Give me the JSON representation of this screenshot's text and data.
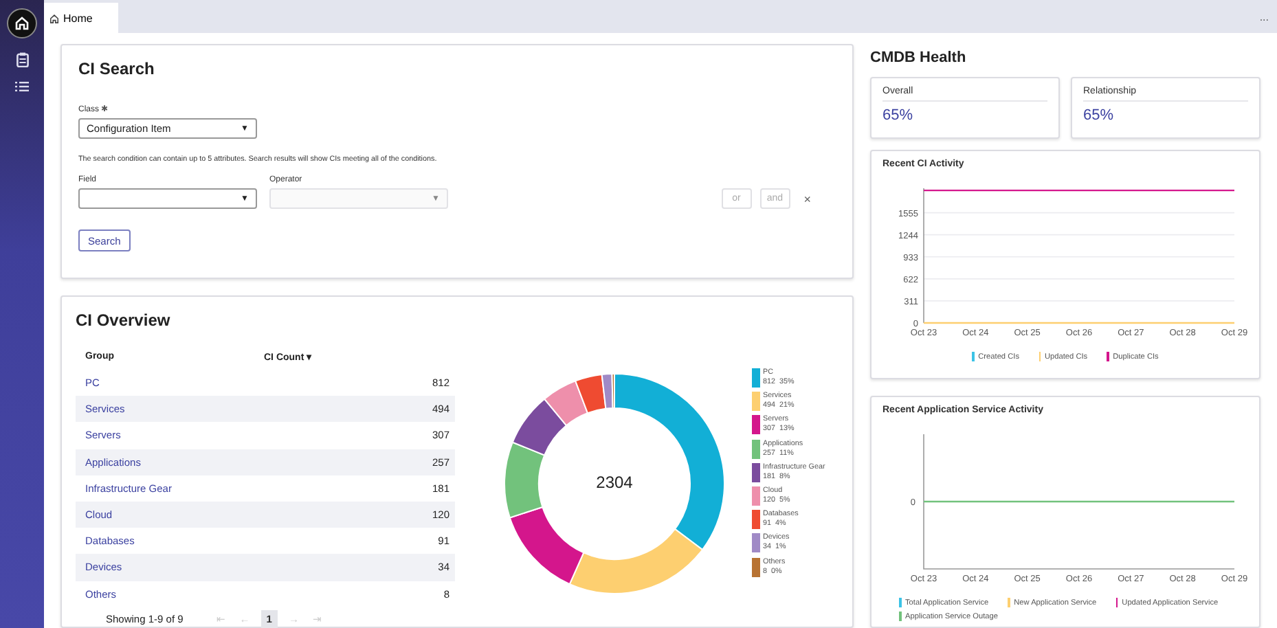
{
  "tab": {
    "label": "Home",
    "selected": true
  },
  "more": "...",
  "search": {
    "title": "CI Search",
    "class_label": "Class",
    "required_mark": "✱",
    "class_value": "Configuration Item",
    "caret": "▼",
    "help": "The search condition can contain up to 5 attributes. Search results will show CIs meeting all of the conditions.",
    "field_label": "Field",
    "operator_label": "Operator",
    "operator_disabled": true,
    "buttons": [
      {
        "label": "or",
        "disabled": true
      },
      {
        "label": "and",
        "disabled": true
      }
    ],
    "remove": "×",
    "search_button": "Search"
  },
  "overview": {
    "title": "CI Overview",
    "columns": [
      "Group",
      "CI Count"
    ],
    "sort_mark": "▾",
    "rows": [
      {
        "group": "PC",
        "count": "812"
      },
      {
        "group": "Services",
        "count": "494"
      },
      {
        "group": "Servers",
        "count": "307"
      },
      {
        "group": "Applications",
        "count": "257"
      },
      {
        "group": "Infrastructure Gear",
        "count": "181"
      },
      {
        "group": "Cloud",
        "count": "120"
      },
      {
        "group": "Databases",
        "count": "91"
      },
      {
        "group": "Devices",
        "count": "34"
      },
      {
        "group": "Others",
        "count": "8"
      }
    ],
    "showing": "Showing 1-9 of 9",
    "pager": [
      {
        "label": "⇤",
        "kind": "nav",
        "disabled": true
      },
      {
        "label": "←",
        "kind": "nav",
        "disabled": true
      },
      {
        "label": "1",
        "kind": "page",
        "selected": true
      },
      {
        "label": "→",
        "kind": "nav",
        "disabled": true
      },
      {
        "label": "⇥",
        "kind": "nav",
        "disabled": true
      }
    ],
    "total": "2304",
    "legend": [
      {
        "count": "812",
        "percent": "35%",
        "color": "#12afd6"
      },
      {
        "count": "494",
        "percent": "21%",
        "color": "#fdcf70"
      },
      {
        "count": "307",
        "percent": "13%",
        "color": "#d4168c"
      },
      {
        "count": "257",
        "percent": "11%",
        "color": "#72c27c"
      },
      {
        "count": "181",
        "percent": "8%",
        "color": "#7b4c9e"
      },
      {
        "count": "120",
        "percent": "5%",
        "color": "#ee8fab"
      },
      {
        "count": "91",
        "percent": "4%",
        "color": "#ef4b31"
      },
      {
        "count": "34",
        "percent": "1%",
        "color": "#a08ac6"
      },
      {
        "count": "8",
        "percent": "0%",
        "color": "#b87333"
      }
    ],
    "chart_data": {
      "type": "donut",
      "categories": [
        "PC",
        "Services",
        "Servers",
        "Applications",
        "Infrastructure Gear",
        "Cloud",
        "Databases",
        "Devices",
        "Others"
      ],
      "values": [
        35.24,
        21.44,
        13.32,
        11.15,
        7.86,
        5.21,
        3.95,
        1.48,
        0.35
      ]
    }
  },
  "health": {
    "title": "CMDB Health",
    "scores": [
      {
        "label": "Overall",
        "value": "65%"
      },
      {
        "label": "Relationship",
        "value": "65%"
      }
    ],
    "charts": [
      {
        "title": "Recent CI Activity",
        "chart_data": {
          "type": "line",
          "x": [
            "Oct 23",
            "Oct 24",
            "Oct 25",
            "Oct 26",
            "Oct 27",
            "Oct 28",
            "Oct 29"
          ],
          "yticks": [
            0,
            311,
            622,
            933,
            1244,
            1555
          ],
          "ylim": [
            0,
            1900
          ],
          "grid": true,
          "series": [
            {
              "name": "Created CIs",
              "color": "#3cc3e6",
              "values": [
                null,
                null,
                null,
                null,
                null,
                null,
                null
              ]
            },
            {
              "name": "Updated CIs",
              "color": "#fdcf70",
              "values": [
                0,
                0,
                0,
                0,
                0,
                0,
                0
              ]
            },
            {
              "name": "Duplicate CIs",
              "color": "#d4168c",
              "values": [
                1870,
                1870,
                1870,
                1870,
                1870,
                1870,
                1870
              ]
            }
          ]
        }
      },
      {
        "title": "Recent Application Service Activity",
        "y_label": "0",
        "x_labels": [
          "Oct 23",
          "Oct 24",
          "Oct 25",
          "Oct 26",
          "Oct 27",
          "Oct 28",
          "Oct 29"
        ],
        "legend": [
          {
            "name": "Total Application Service",
            "color": "#3cc3e6"
          },
          {
            "name": "New Application Service",
            "color": "#fdcf70"
          },
          {
            "name": "Updated Application Service",
            "color": "#d4168c"
          },
          {
            "name": "Application Service Outage",
            "color": "#72c27c"
          }
        ]
      }
    ]
  }
}
